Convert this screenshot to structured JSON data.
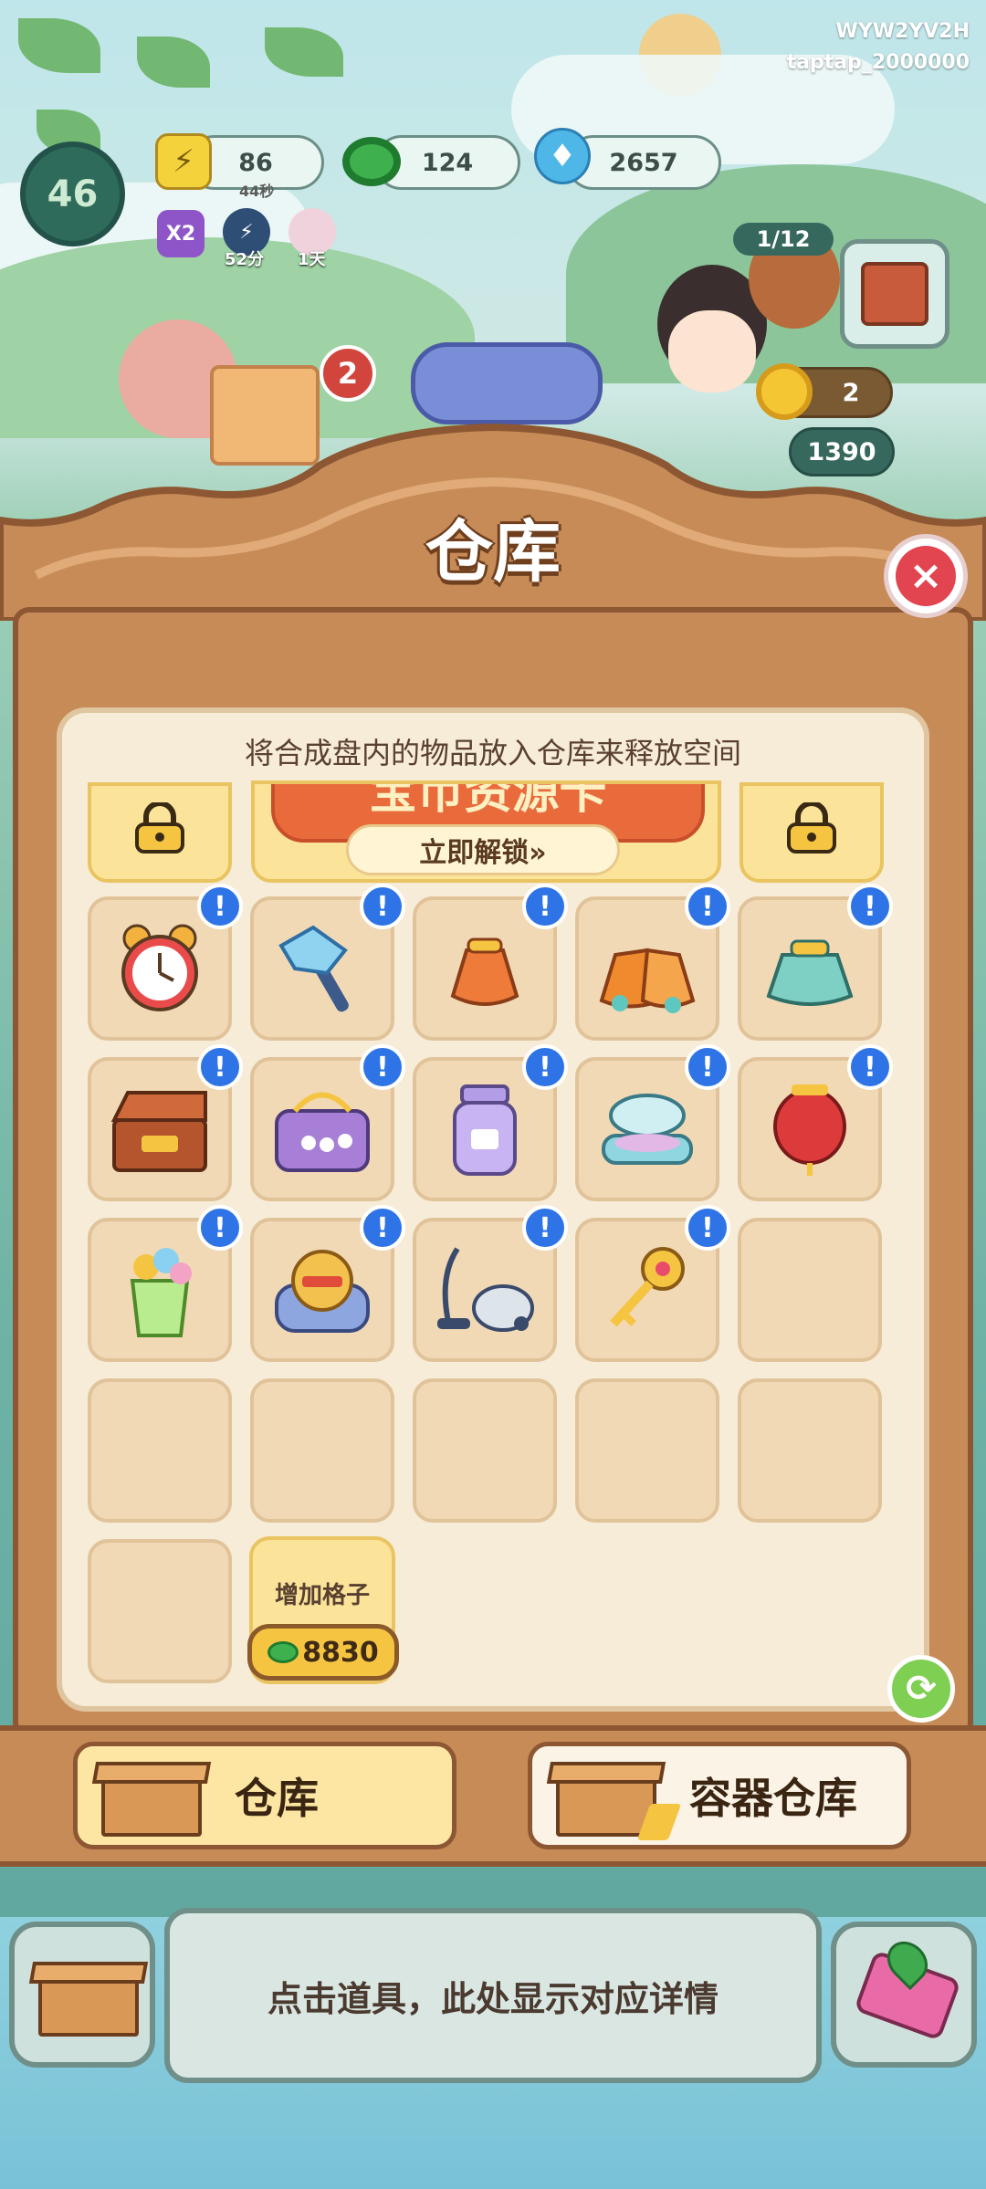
{
  "hud": {
    "account_code": "WYW2YV2H",
    "account_id": "taptap_2000000",
    "level": "46",
    "energy": "86",
    "energy_timer": "44秒",
    "coins": "124",
    "gems": "2657",
    "boost_label": "X2",
    "boost1_timer": "52分",
    "boost2_timer": "1天",
    "notification_count": "2",
    "visitor_progress": "1/12",
    "flower_count": "2",
    "gem_reward": "1390"
  },
  "warehouse": {
    "title": "仓库",
    "subtitle": "将合成盘内的物品放入仓库来释放空间",
    "promo_title": "宝币资源卡",
    "promo_button": "立即解锁»",
    "add_slot_label": "增加格子",
    "add_slot_cost": "8830",
    "items": [
      {
        "icon": "alarm-clock-icon"
      },
      {
        "icon": "crystal-hammer-icon"
      },
      {
        "icon": "orange-pouch-icon"
      },
      {
        "icon": "treasure-bags-icon"
      },
      {
        "icon": "jade-pouch-icon"
      },
      {
        "icon": "jewelry-chest-icon"
      },
      {
        "icon": "pearl-necklace-icon"
      },
      {
        "icon": "purple-jar-icon"
      },
      {
        "icon": "compact-powder-icon"
      },
      {
        "icon": "red-lantern-icon"
      },
      {
        "icon": "flower-vase-icon"
      },
      {
        "icon": "lion-dance-plush-icon"
      },
      {
        "icon": "vacuum-cleaner-icon"
      },
      {
        "icon": "golden-key-icon"
      }
    ],
    "badge_mark": "!"
  },
  "tabs": {
    "warehouse": "仓库",
    "container_warehouse": "容器仓库"
  },
  "detail": {
    "hint": "点击道具，此处显示对应详情"
  },
  "colors": {
    "wood": "#c78b57",
    "wood_dark": "#8c5732",
    "panel": "#f7ecd8",
    "cell": "#f1d9b5",
    "badge_blue": "#2f74e6",
    "close_red": "#e2454f"
  }
}
